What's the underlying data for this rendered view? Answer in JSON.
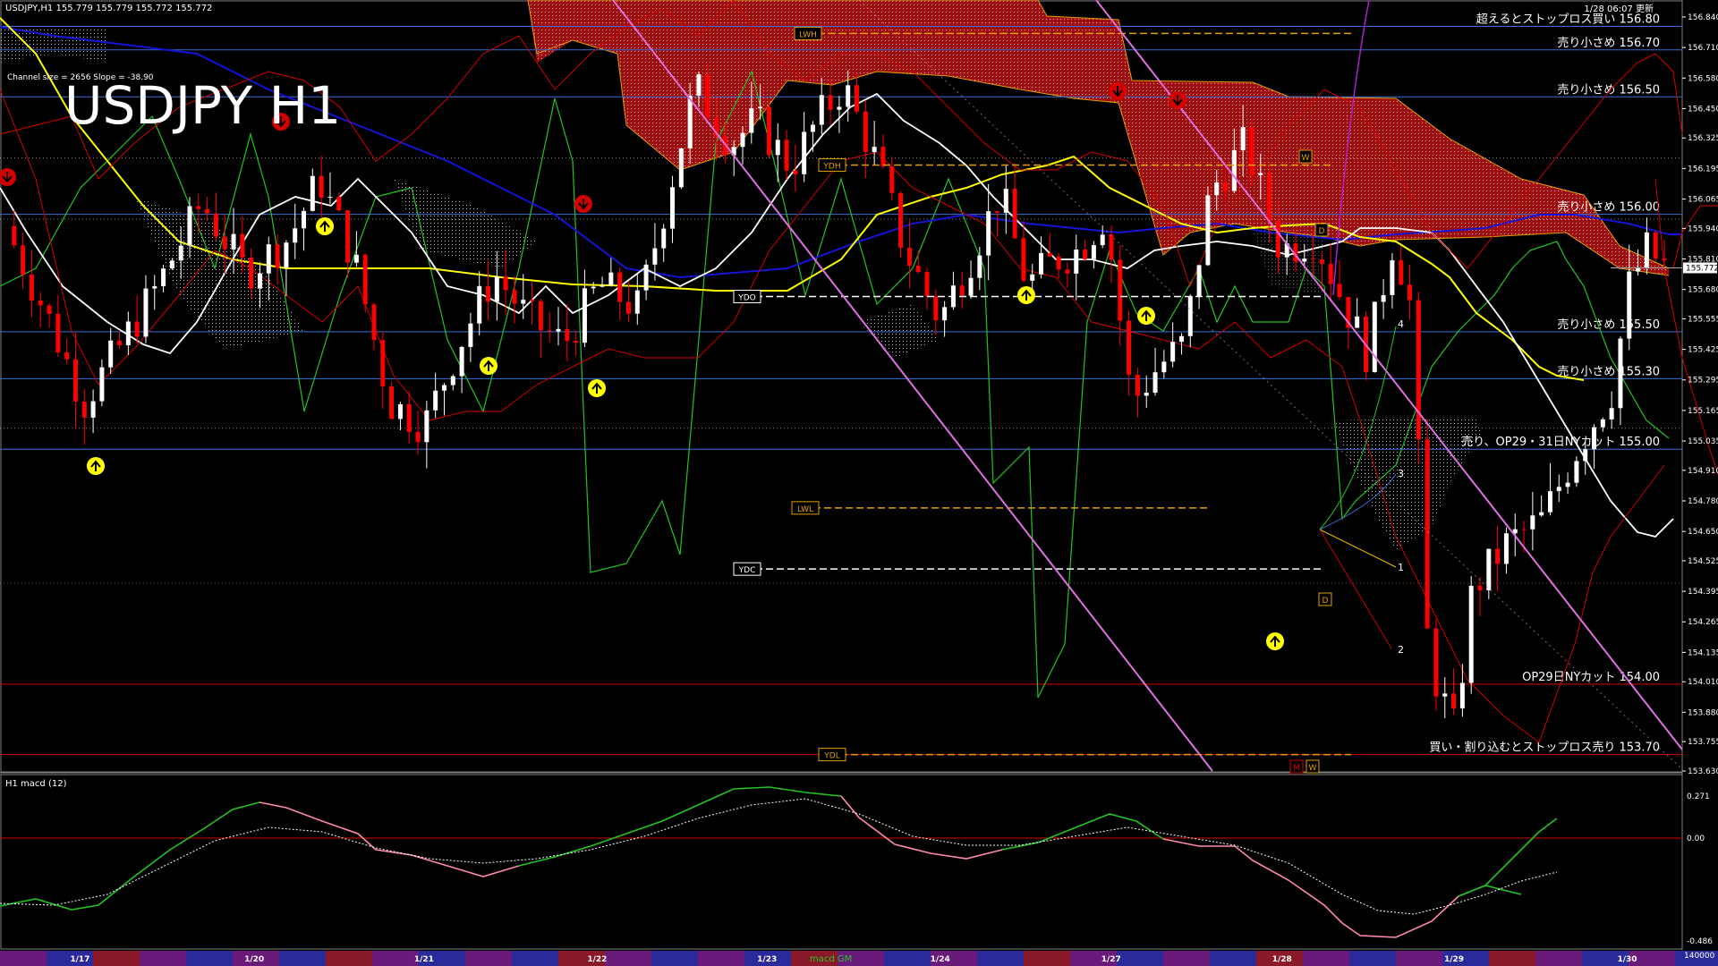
{
  "header": {
    "symbol_info": "USDJPY,H1  155.779 155.779 155.772 155.772",
    "updated": "1/28 06:07 更新",
    "channel_info": "Channel size = 2656 Slope = -38.90",
    "big_title": "USDJPY H1"
  },
  "macd_panel": {
    "title": "H1  macd (12)",
    "ticks": [
      "0.271",
      "0.00",
      "-0.486"
    ],
    "scale_note": "140000",
    "bottom_label": "macd GM"
  },
  "colors": {
    "background": "#000000",
    "bull": "#ffffff",
    "bear": "#ff0000",
    "ma_yellow": "#ffff00",
    "ma_blue": "#1414d8",
    "ma_white": "#ffffff",
    "bollinger": "#d40000",
    "oscillator_green": "#22c422",
    "cloud": "#b01010",
    "channel": "#e070e0",
    "level_line": "#3a6fd8"
  },
  "chart_data": {
    "type": "candlestick",
    "symbol": "USDJPY",
    "timeframe": "H1",
    "ylim": [
      153.63,
      156.84
    ],
    "last_price": "155.772",
    "y_ticks": [
      "156.840",
      "156.710",
      "156.580",
      "156.450",
      "156.325",
      "156.195",
      "156.065",
      "155.940",
      "155.810",
      "155.680",
      "155.555",
      "155.425",
      "155.295",
      "155.165",
      "155.035",
      "154.910",
      "154.780",
      "154.650",
      "154.525",
      "154.395",
      "154.265",
      "154.135",
      "154.010",
      "153.880",
      "153.755",
      "153.630"
    ],
    "dates": [
      {
        "label": "1/17",
        "x": 73
      },
      {
        "label": "1/20",
        "x": 232
      },
      {
        "label": "1/21",
        "x": 387
      },
      {
        "label": "1/22",
        "x": 545
      },
      {
        "label": "1/23",
        "x": 700
      },
      {
        "label": "1/24",
        "x": 858
      },
      {
        "label": "1/27",
        "x": 1014
      },
      {
        "label": "1/28",
        "x": 1170
      },
      {
        "label": "1/29",
        "x": 1327
      },
      {
        "label": "1/30",
        "x": 1485
      }
    ],
    "levels": [
      {
        "price": 156.8,
        "text": "超えるとストップロス買い 156.80",
        "color": "#3a6fd8"
      },
      {
        "price": 156.7,
        "text": "売り小さめ 156.70",
        "color": "#3a6fd8"
      },
      {
        "price": 156.5,
        "text": "売り小さめ 156.50",
        "color": "#3a6fd8"
      },
      {
        "price": 156.0,
        "text": "売り小さめ 156.00",
        "color": "#3a6fd8"
      },
      {
        "price": 155.5,
        "text": "売り小さめ 155.50",
        "color": "#3a6fd8"
      },
      {
        "price": 155.3,
        "text": "売り小さめ 155.30",
        "color": "#3a6fd8"
      },
      {
        "price": 155.0,
        "text": "売り、OP29・31日NYカット 155.00",
        "color": "#3a6fd8"
      },
      {
        "price": 154.0,
        "text": "OP29日NYカット 154.00",
        "color": "#d40000"
      },
      {
        "price": 153.7,
        "text": "買い・割り込むとストップロス売り 153.70",
        "color": "#d40000"
      }
    ],
    "ref_lines": [
      {
        "label": "LWH",
        "price": 156.77,
        "color": "#e0a000"
      },
      {
        "label": "YDH",
        "price": 156.21,
        "color": "#e0a000"
      },
      {
        "label": "YDO",
        "price": 155.65,
        "color": "#ffffff"
      },
      {
        "label": "LWL",
        "price": 154.75,
        "color": "#e0a000"
      },
      {
        "label": "YDC",
        "price": 154.49,
        "color": "#ffffff"
      },
      {
        "label": "YDL",
        "price": 153.7,
        "color": "#e0a000"
      }
    ],
    "markers": [
      "W",
      "D",
      "D",
      "M",
      "W"
    ],
    "wave_labels": [
      "1",
      "2",
      "3",
      "4"
    ]
  }
}
